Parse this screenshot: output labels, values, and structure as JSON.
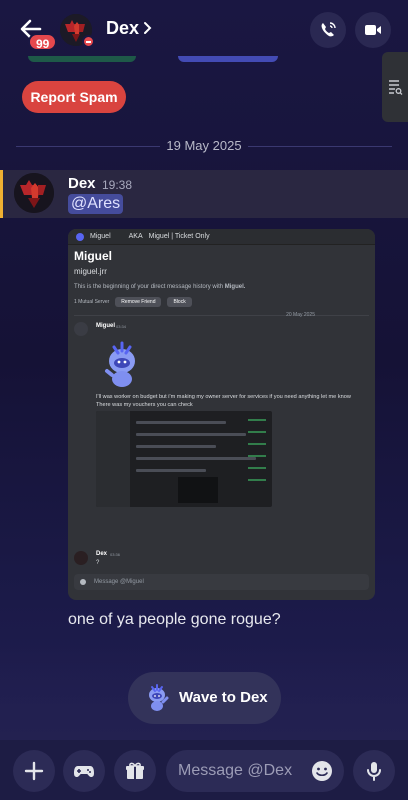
{
  "header": {
    "badge_count": "99",
    "title": "Dex"
  },
  "actions": {
    "report_spam": "Report Spam"
  },
  "date_divider": "19 May 2025",
  "message": {
    "author": "Dex",
    "time": "19:38",
    "mention": "@Ares",
    "text": "one of ya people gone rogue?"
  },
  "embed": {
    "topbar_name": "Miguel",
    "topbar_aka": "AKA",
    "topbar_server": "Miguel | Ticket Only",
    "title": "Miguel",
    "handle": "miguel.jrr",
    "intro_prefix": "This is the beginning of your direct message history with ",
    "intro_name": "Miguel.",
    "mutual": "1 Mutual Server",
    "remove_friend": "Remove Friend",
    "block": "Block",
    "date": "20 May 2025",
    "sender": "Miguel",
    "sender_time": "03:34",
    "message_line1": "I'll was worker on budget but i'm making my owner server for services if you need anything let me know",
    "message_line2": "There was my vouchers you can check",
    "reply_author": "Dex",
    "reply_time": "03:36",
    "reply_text": "?",
    "input_placeholder": "Message @Miguel"
  },
  "wave": {
    "label": "Wave to Dex"
  },
  "composer": {
    "placeholder": "Message @Dex"
  },
  "colors": {
    "accent_red": "#d9443f",
    "mention_bg": "#454c9c",
    "highlight_bar": "#f0b132"
  }
}
